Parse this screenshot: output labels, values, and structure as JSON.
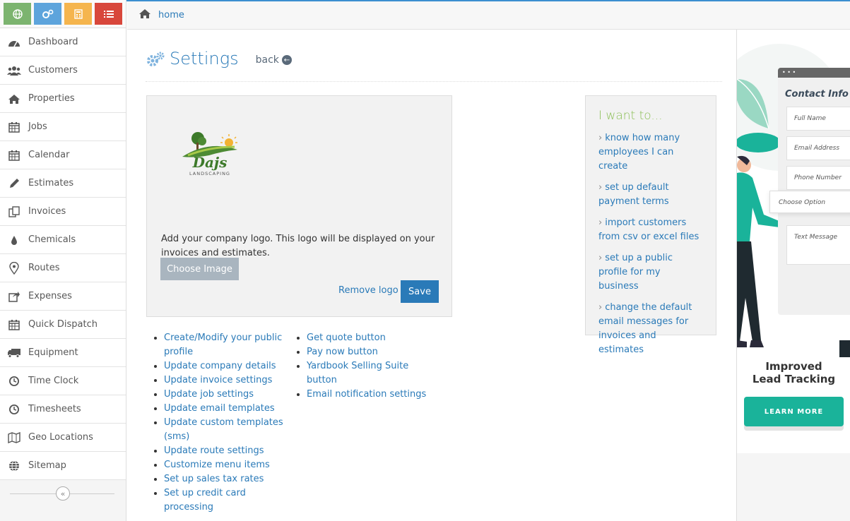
{
  "shortcuts": [
    {
      "name": "globe-shortcut",
      "color": "#7cb46f",
      "icon": "globe-icon"
    },
    {
      "name": "gears-shortcut",
      "color": "#5da4dc",
      "icon": "gears-icon"
    },
    {
      "name": "calculator-shortcut",
      "color": "#f5b54e",
      "icon": "calculator-icon"
    },
    {
      "name": "list-shortcut",
      "color": "#d8473b",
      "icon": "list-icon"
    }
  ],
  "sidebar": {
    "items": [
      {
        "label": "Dashboard",
        "icon": "dashboard-icon"
      },
      {
        "label": "Customers",
        "icon": "users-icon"
      },
      {
        "label": "Properties",
        "icon": "home-icon"
      },
      {
        "label": "Jobs",
        "icon": "calendar-icon"
      },
      {
        "label": "Calendar",
        "icon": "calendar-icon"
      },
      {
        "label": "Estimates",
        "icon": "pencil-icon"
      },
      {
        "label": "Invoices",
        "icon": "copy-icon"
      },
      {
        "label": "Chemicals",
        "icon": "drop-icon"
      },
      {
        "label": "Routes",
        "icon": "map-marker-icon"
      },
      {
        "label": "Expenses",
        "icon": "share-icon"
      },
      {
        "label": "Quick Dispatch",
        "icon": "calendar-icon"
      },
      {
        "label": "Equipment",
        "icon": "truck-icon"
      },
      {
        "label": "Time Clock",
        "icon": "clock-icon"
      },
      {
        "label": "Timesheets",
        "icon": "clock-icon"
      },
      {
        "label": "Geo Locations",
        "icon": "map-icon"
      },
      {
        "label": "Sitemap",
        "icon": "globe-icon"
      }
    ],
    "collapse_label": "«"
  },
  "breadcrumb": {
    "home_label": "home"
  },
  "header": {
    "title": "Settings",
    "back_label": "back"
  },
  "logo_panel": {
    "logo_text": "Dajs",
    "logo_subtext": "LANDSCAPING",
    "description": "Add your company logo. This logo will be displayed on your invoices and estimates.",
    "choose_image_label": "Choose Image",
    "remove_logo_label": "Remove logo",
    "save_label": "Save"
  },
  "links_col1": [
    "Create/Modify your public profile",
    "Update company details",
    "Update invoice settings",
    "Update job settings",
    "Update email templates",
    "Update custom templates (sms)",
    "Update route settings",
    "Customize menu items",
    "Set up sales tax rates",
    "Set up credit card processing"
  ],
  "links_col2": [
    "Get quote button",
    "Pay now button",
    "Yardbook Selling Suite button",
    "Email notification settings"
  ],
  "iwant": {
    "title": "I want to...",
    "items": [
      "know how many employees I can create",
      "set up default payment terms",
      "import customers from csv or excel files",
      "set up a public profile for my business",
      "change the default email messages for invoices and estimates"
    ]
  },
  "ad": {
    "form_title": "Contact Info",
    "fields": [
      "Full Name",
      "Email Address",
      "Phone Number"
    ],
    "choose_option": "Choose Option",
    "text_message": "Text Message",
    "headline_line1": "Improved",
    "headline_line2": "Lead Tracking",
    "cta_label": "LEARN MORE"
  }
}
